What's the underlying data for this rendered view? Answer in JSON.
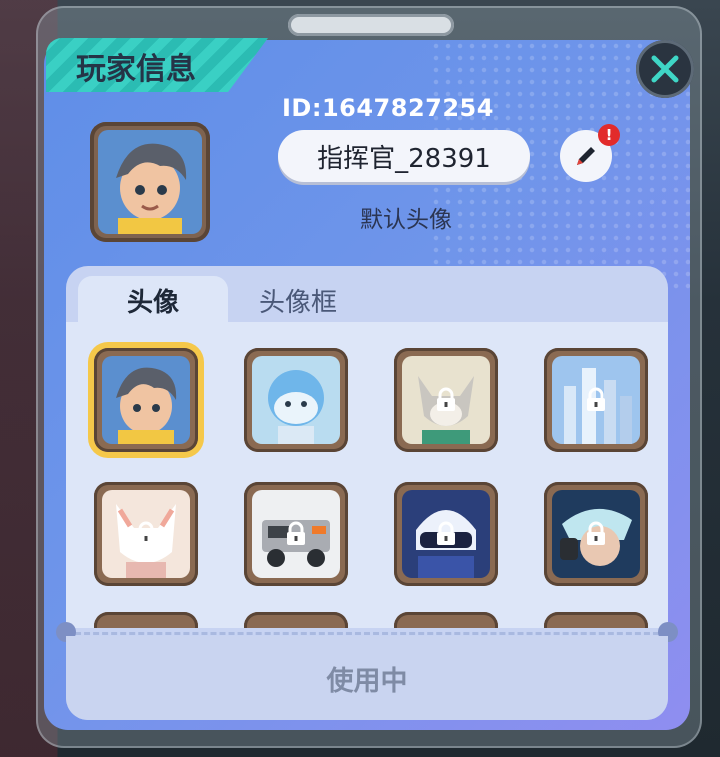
{
  "panel": {
    "title": "玩家信息",
    "player_id": "ID:1647827254",
    "player_name": "指挥官_28391",
    "avatar_caption": "默认头像",
    "edit_badge": "!"
  },
  "tabs": [
    {
      "label": "头像",
      "active": true
    },
    {
      "label": "头像框",
      "active": false
    }
  ],
  "avatars": [
    {
      "name": "boy-hero",
      "locked": false,
      "selected": true
    },
    {
      "name": "blue-robot",
      "locked": false,
      "selected": false
    },
    {
      "name": "wolf",
      "locked": true,
      "selected": false
    },
    {
      "name": "city",
      "locked": true,
      "selected": false
    },
    {
      "name": "fox",
      "locked": true,
      "selected": false
    },
    {
      "name": "vehicle",
      "locked": true,
      "selected": false
    },
    {
      "name": "blue-helmet",
      "locked": true,
      "selected": false
    },
    {
      "name": "cyber-girl",
      "locked": true,
      "selected": false
    }
  ],
  "status_label": "使用中",
  "colors": {
    "panel_blue": "#6f95ea",
    "title_teal": "#3ad0c4",
    "selected_gold": "#f5c84a",
    "badge_red": "#e22b2b"
  }
}
